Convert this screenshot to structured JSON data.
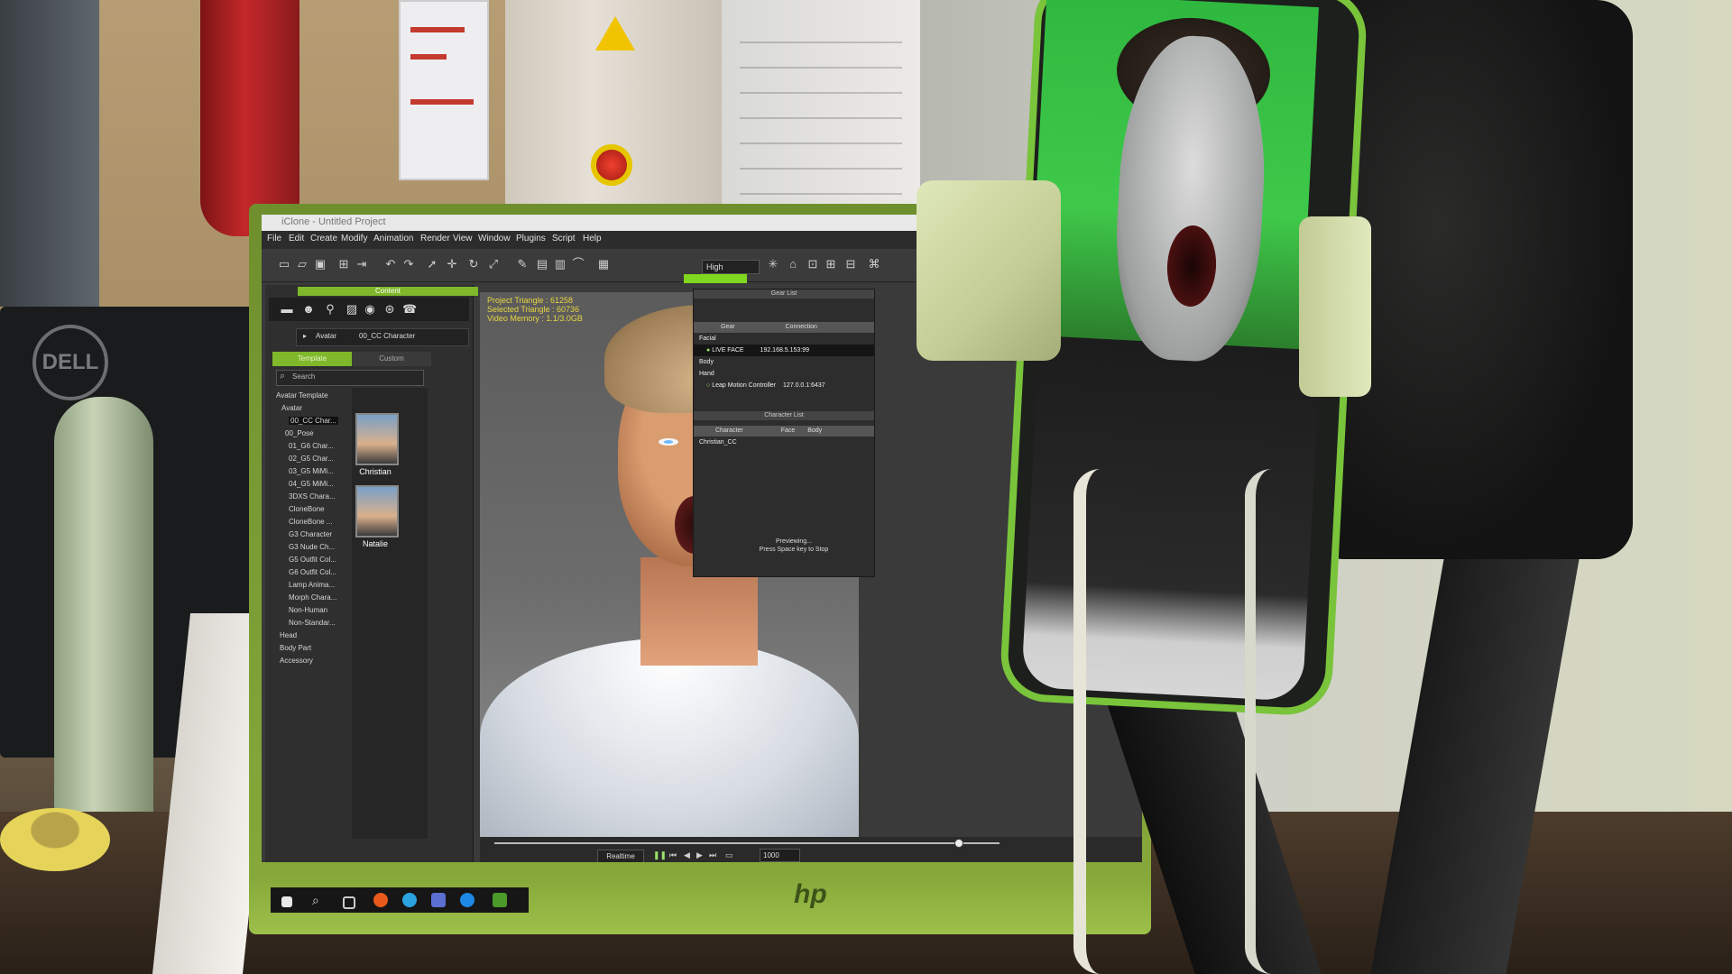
{
  "window": {
    "title": "iClone - Untitled Project",
    "menu": [
      "File",
      "Edit",
      "Create",
      "Modify",
      "Animation",
      "Render",
      "View",
      "Window",
      "Plugins",
      "Script",
      "Help"
    ],
    "quality": "High"
  },
  "content_panel": {
    "title": "Content",
    "breadcrumb": [
      "Avatar",
      "00_CC Character"
    ],
    "tabs": [
      "Template",
      "Custom"
    ],
    "search_placeholder": "Search",
    "tree": [
      "Avatar Template",
      "Avatar",
      "00_CC Char...",
      "00_Pose",
      "01_G6 Char...",
      "02_G5 Char...",
      "03_G5 MiMi...",
      "04_G5 MiMi...",
      "3DXS Chara...",
      "CloneBone",
      "CloneBone ...",
      "G3 Character",
      "G3 Nude Ch...",
      "G5 Outfit Col...",
      "G6 Outfit Col...",
      "Lamp Anima...",
      "Morph Chara...",
      "Non-Human",
      "Non-Standar...",
      "Head",
      "Body Part",
      "Accessory"
    ],
    "thumbnails": [
      "Christian",
      "Natalie"
    ]
  },
  "viewport": {
    "hud_lines": [
      "Project Triangle : 61258",
      "Selected Triangle : 60736",
      "Video Memory : 1.1/3.0GB"
    ]
  },
  "gear_panel": {
    "title": "Gear List",
    "columns": [
      "Gear",
      "Connection"
    ],
    "rows": [
      {
        "name": "Facial",
        "conn": ""
      },
      {
        "name": "LIVE FACE",
        "conn": "192.168.5.153:99"
      },
      {
        "name": "Body",
        "conn": ""
      },
      {
        "name": "Hand",
        "conn": ""
      },
      {
        "name": "Leap Motion Controller",
        "conn": "127.0.0.1:6437"
      }
    ],
    "character_title": "Character List",
    "character_columns": [
      "Character",
      "Face",
      "Body"
    ],
    "character_rows": [
      "Christian_CC"
    ],
    "status": [
      "Previewing...",
      "Press Space key to Stop"
    ]
  },
  "timeline": {
    "realtime_label": "Realtime",
    "frame": "1000",
    "progress": 0.92
  },
  "brands": {
    "left_monitor": "DELL",
    "main_monitor": "hp"
  },
  "colors": {
    "accent_green": "#7fb82a",
    "hud_yellow": "#e8d640",
    "phone_green": "#79c43b"
  }
}
